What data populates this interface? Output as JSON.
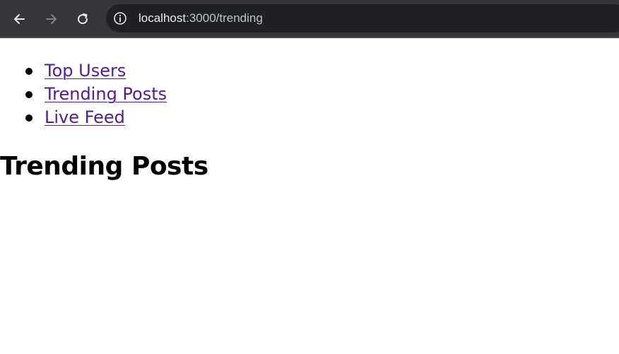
{
  "browser": {
    "url_host": "localhost",
    "url_rest": ":3000/trending",
    "icons": {
      "back": "arrow-left-icon",
      "forward": "arrow-right-icon",
      "reload": "reload-icon",
      "site_info": "info-icon"
    },
    "colors": {
      "toolbar": "#35363a",
      "omnibox": "#202124",
      "icon": "#e8eaed",
      "icon_disabled": "#7f8084"
    }
  },
  "nav": {
    "items": [
      {
        "label": "Top Users"
      },
      {
        "label": "Trending Posts"
      },
      {
        "label": "Live Feed"
      }
    ],
    "link_color": "#551a8b"
  },
  "main": {
    "title": "Trending Posts"
  }
}
